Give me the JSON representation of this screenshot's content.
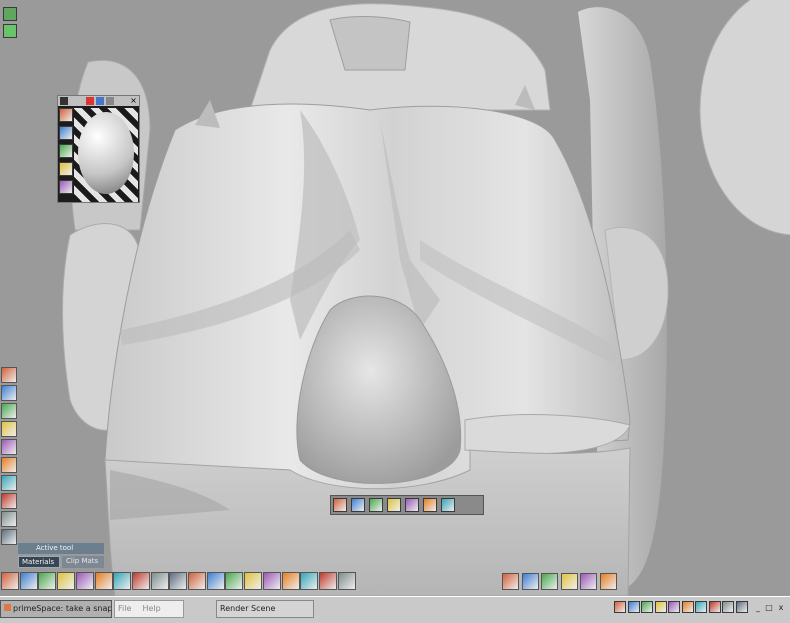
{
  "taskbar": {
    "active_task": "primeSpace: take a snap shot...",
    "menu": [
      "File",
      "Help"
    ],
    "scene_label": "Render Scene",
    "window_controls": [
      "_",
      "□",
      "x"
    ]
  },
  "floating_panel": {
    "tabs": [
      "Active tool",
      "Materials",
      "Clip Mats"
    ]
  },
  "material_palette": {
    "tools": [
      "paint-brush-icon",
      "brush-icon",
      "knife-icon",
      "flat-color-icon",
      "wood-icon"
    ]
  },
  "left_toolbar": {
    "tools": [
      "light-icon",
      "deform-icon",
      "palette-icon",
      "color-icon",
      "gradient-icon",
      "arrow-icon",
      "cube-icon",
      "landscape-icon",
      "move-icon",
      "path-icon"
    ]
  },
  "bottom_toolbar": {
    "tools": [
      "circle-icon",
      "pencil-icon",
      "lathe-icon",
      "extrude-icon",
      "color-ball-icon",
      "texture-icon",
      "grid-icon",
      "shaper-icon",
      "waves-icon",
      "puzzle-icon",
      "morph-icon",
      "sphere-icon",
      "tree-icon",
      "axis-icon",
      "figure-icon",
      "knife-icon",
      "wand-icon",
      "lighting-icon",
      "eye-icon"
    ]
  },
  "right_toolbar": {
    "tools": [
      "shader-icon",
      "select-icon",
      "group-icon",
      "file-icon",
      "brush-icon",
      "help-icon"
    ]
  },
  "tray": {
    "icons": [
      "app1-icon",
      "app2-icon",
      "app3-icon",
      "app4-icon",
      "app5-icon",
      "app6-icon",
      "app7-icon",
      "app8-icon",
      "app9-icon",
      "app10-icon"
    ]
  },
  "floating_toolbar": {
    "tools": [
      "move-icon",
      "rotate-icon",
      "scale-icon",
      "twist-icon",
      "spin-icon",
      "bend-icon",
      "view-icon"
    ]
  }
}
